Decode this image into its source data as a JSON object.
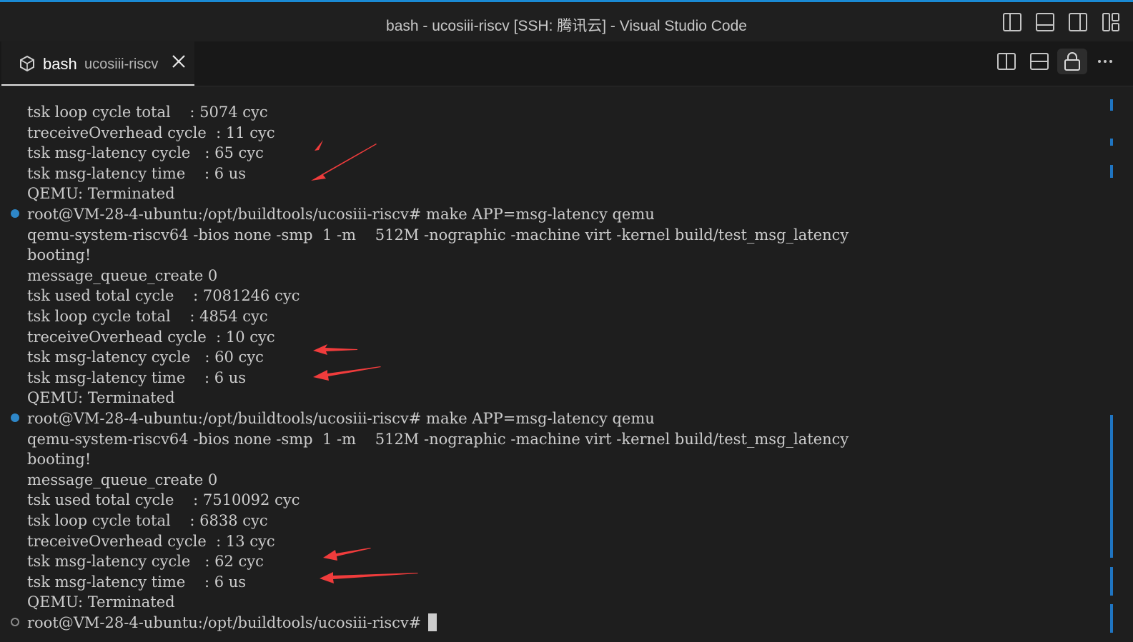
{
  "window": {
    "title": "bash - ucosiii-riscv [SSH: 腾讯云] - Visual Studio Code"
  },
  "titlebar_icons": [
    "toggle-primary-sidebar-icon",
    "toggle-panel-icon",
    "toggle-secondary-sidebar-icon",
    "customize-layout-icon"
  ],
  "tab": {
    "name": "bash",
    "description": "ucosiii-riscv",
    "close_icon": "close-icon",
    "shell_icon": "terminal-shell-icon"
  },
  "tab_actions": [
    "split-editor-right-icon",
    "split-editor-down-icon",
    "lock-icon",
    "more-actions-icon"
  ],
  "terminal": {
    "lines": [
      {
        "text": "tsk loop cycle total    : 5074 cyc",
        "marker": "none"
      },
      {
        "text": "treceiveOverhead cycle  : 11 cyc",
        "marker": "none"
      },
      {
        "text": "tsk msg-latency cycle   : 65 cyc",
        "marker": "none"
      },
      {
        "text": "tsk msg-latency time    : 6 us",
        "marker": "none"
      },
      {
        "text": "QEMU: Terminated",
        "marker": "none"
      },
      {
        "text": "root@VM-28-4-ubuntu:/opt/buildtools/ucosiii-riscv# make APP=msg-latency qemu",
        "marker": "success"
      },
      {
        "text": "qemu-system-riscv64 -bios none -smp  1 -m    512M -nographic -machine virt -kernel build/test_msg_latency",
        "marker": "none"
      },
      {
        "text": "booting!",
        "marker": "none"
      },
      {
        "text": "message_queue_create 0",
        "marker": "none"
      },
      {
        "text": "tsk used total cycle    : 7081246 cyc",
        "marker": "none"
      },
      {
        "text": "tsk loop cycle total    : 4854 cyc",
        "marker": "none"
      },
      {
        "text": "treceiveOverhead cycle  : 10 cyc",
        "marker": "none"
      },
      {
        "text": "tsk msg-latency cycle   : 60 cyc",
        "marker": "none"
      },
      {
        "text": "tsk msg-latency time    : 6 us",
        "marker": "none"
      },
      {
        "text": "QEMU: Terminated",
        "marker": "none"
      },
      {
        "text": "root@VM-28-4-ubuntu:/opt/buildtools/ucosiii-riscv# make APP=msg-latency qemu",
        "marker": "success"
      },
      {
        "text": "qemu-system-riscv64 -bios none -smp  1 -m    512M -nographic -machine virt -kernel build/test_msg_latency",
        "marker": "none"
      },
      {
        "text": "booting!",
        "marker": "none"
      },
      {
        "text": "message_queue_create 0",
        "marker": "none"
      },
      {
        "text": "tsk used total cycle    : 7510092 cyc",
        "marker": "none"
      },
      {
        "text": "tsk loop cycle total    : 6838 cyc",
        "marker": "none"
      },
      {
        "text": "treceiveOverhead cycle  : 13 cyc",
        "marker": "none"
      },
      {
        "text": "tsk msg-latency cycle   : 62 cyc",
        "marker": "none"
      },
      {
        "text": "tsk msg-latency time    : 6 us",
        "marker": "none"
      },
      {
        "text": "QEMU: Terminated",
        "marker": "none"
      },
      {
        "text": "root@VM-28-4-ubuntu:/opt/buildtools/ucosiii-riscv#",
        "marker": "empty",
        "cursor": true
      }
    ]
  },
  "colors": {
    "accent": "#1a8ad4",
    "annotation_arrow": "#f03c3c",
    "decoration_success": "#2e87c8"
  }
}
